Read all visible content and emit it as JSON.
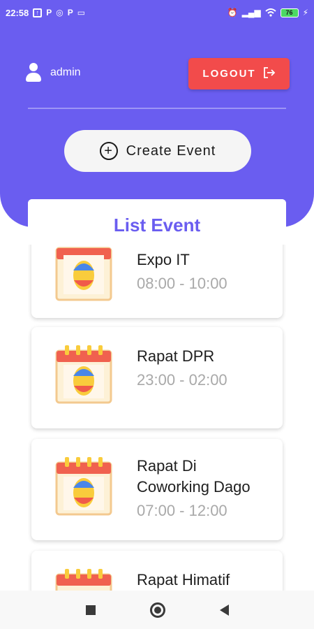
{
  "status_bar": {
    "time": "22:58",
    "battery": "76"
  },
  "user": {
    "name": "admin"
  },
  "logout": {
    "label": "LOGOUT"
  },
  "create_event": {
    "label": "Create Event"
  },
  "list": {
    "title": "List Event",
    "events": [
      {
        "title": "Expo IT",
        "time": "08:00 - 10:00"
      },
      {
        "title": "Rapat DPR",
        "time": "23:00 - 02:00"
      },
      {
        "title": "Rapat Di Coworking Dago",
        "time": "07:00 - 12:00"
      },
      {
        "title": "Rapat Himatif",
        "time": ""
      }
    ]
  },
  "icons": {
    "event": "calendar-egg-icon",
    "user": "user-icon",
    "logout": "logout-icon",
    "create": "add-circle-icon"
  },
  "colors": {
    "primary": "#6a5df0",
    "logout": "#f24b4b",
    "card_background": "#ffffff"
  }
}
